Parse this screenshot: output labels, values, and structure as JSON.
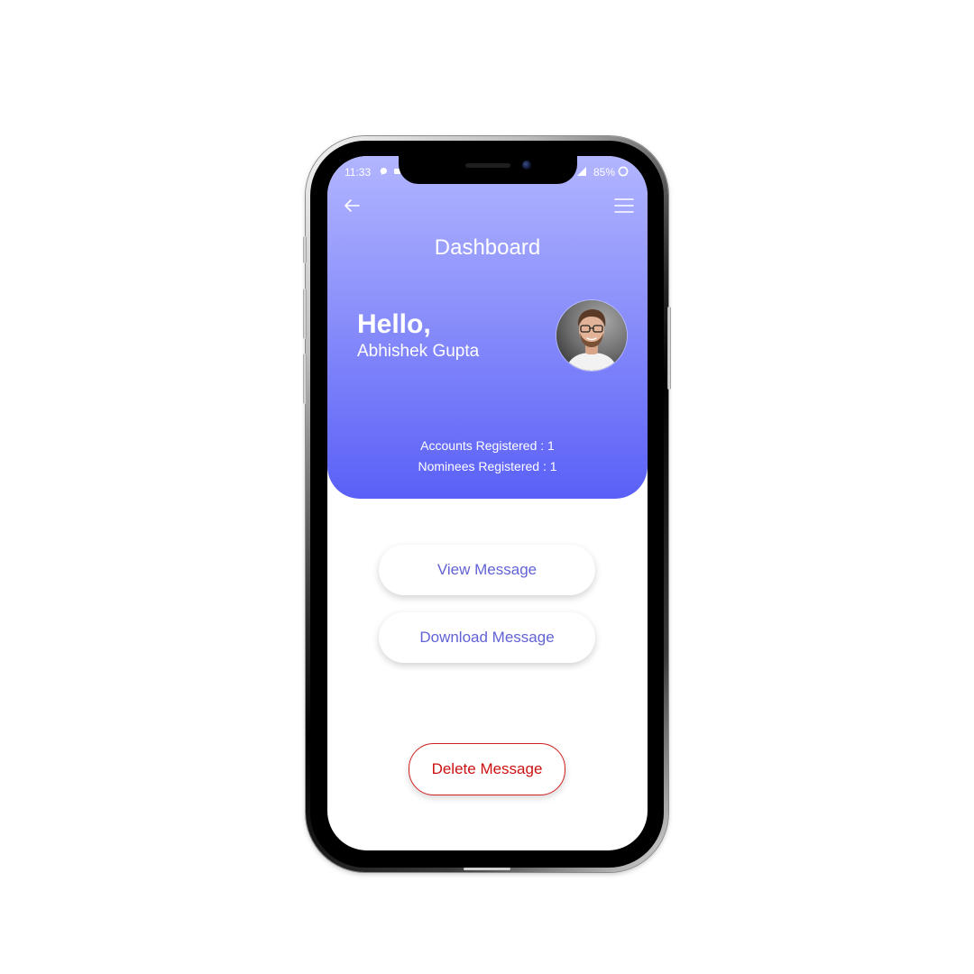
{
  "status_bar": {
    "time": "11:33",
    "battery": "85%"
  },
  "header": {
    "title": "Dashboard",
    "greeting": "Hello,",
    "user_name": "Abhishek Gupta",
    "stats": [
      "Accounts Registered : 1",
      "Nominees Registered : 1"
    ]
  },
  "actions": {
    "view_label": "View Message",
    "download_label": "Download Message",
    "delete_label": "Delete Message"
  },
  "colors": {
    "header_top": "#b2b5ff",
    "header_bottom": "#5a60f7",
    "accent_text": "#6262d6",
    "danger": "#cc1111"
  },
  "icons": {
    "back": "arrow-left-icon",
    "menu": "hamburger-menu-icon"
  }
}
